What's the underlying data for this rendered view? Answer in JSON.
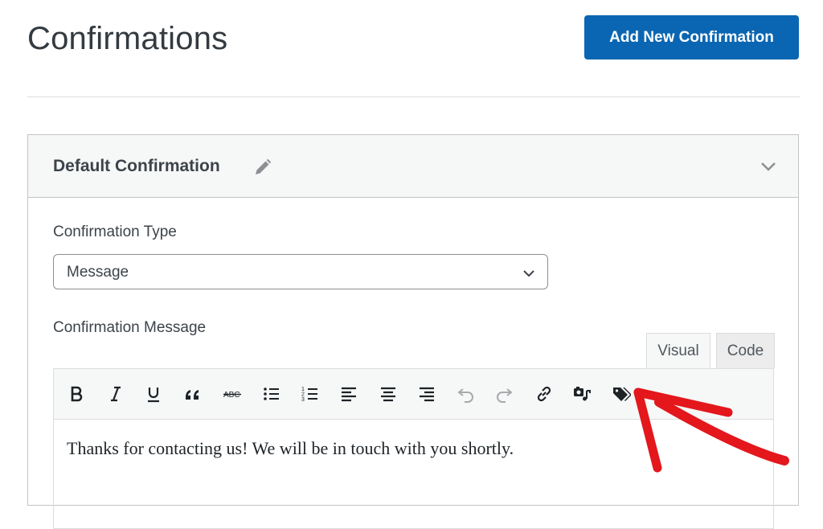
{
  "header": {
    "title": "Confirmations",
    "add_button_label": "Add New Confirmation"
  },
  "card": {
    "title": "Default Confirmation",
    "type_label": "Confirmation Type",
    "type_value": "Message",
    "message_label": "Confirmation Message",
    "editor_tabs": [
      "Visual",
      "Code"
    ],
    "active_tab": "Visual",
    "message_text": "Thanks for contacting us! We will be in touch with you shortly."
  },
  "toolbar_icons": [
    "bold-icon",
    "italic-icon",
    "underline-icon",
    "blockquote-icon",
    "strikethrough-icon",
    "bulleted-list-icon",
    "numbered-list-icon",
    "align-left-icon",
    "align-center-icon",
    "align-right-icon",
    "undo-icon",
    "redo-icon",
    "link-icon",
    "add-media-icon",
    "smart-tags-icon"
  ],
  "colors": {
    "primary_button": "#0a66b2",
    "annotation_arrow": "#e3171c"
  }
}
